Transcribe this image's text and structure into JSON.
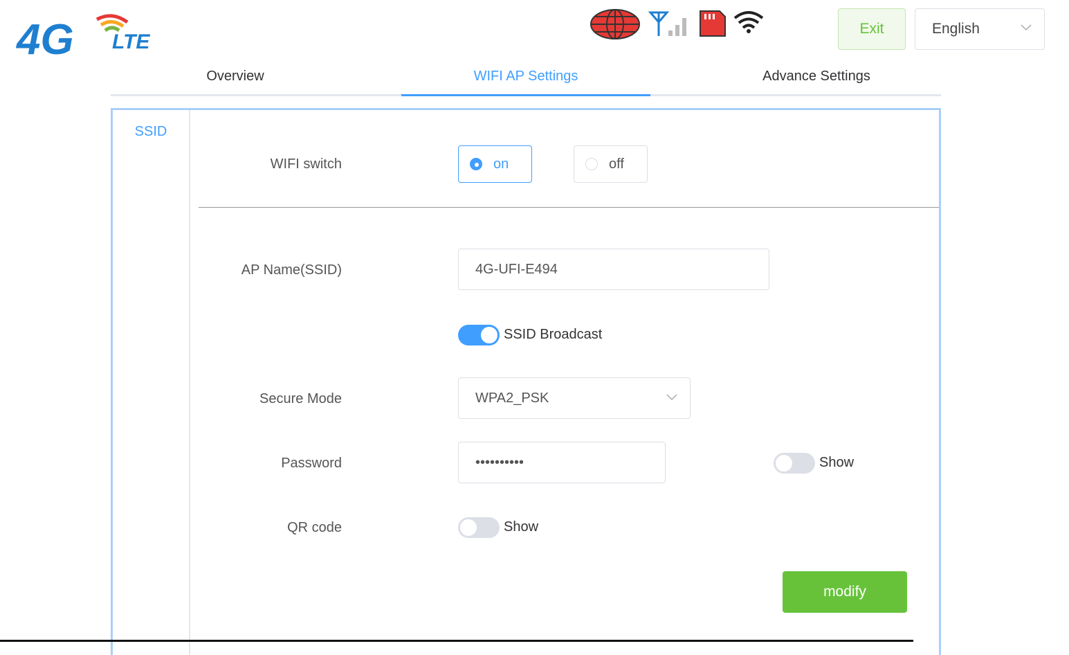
{
  "header": {
    "logo_text": "4G LTE",
    "status_icons": [
      "globe-icon",
      "signal-icon",
      "sim-card-icon",
      "wifi-icon"
    ],
    "exit_label": "Exit",
    "language": {
      "selected": "English"
    }
  },
  "tabs": [
    {
      "label": "Overview",
      "active": false
    },
    {
      "label": "WIFI AP Settings",
      "active": true
    },
    {
      "label": "Advance Settings",
      "active": false
    }
  ],
  "sidebar": {
    "items": [
      {
        "label": "SSID",
        "active": true
      }
    ]
  },
  "form": {
    "wifi_switch": {
      "label": "WIFI switch",
      "options": [
        {
          "label": "on",
          "checked": true
        },
        {
          "label": "off",
          "checked": false
        }
      ]
    },
    "ap_name": {
      "label": "AP Name(SSID)",
      "value": "4G-UFI-E494"
    },
    "ssid_broadcast": {
      "label": "SSID Broadcast",
      "enabled": true
    },
    "secure_mode": {
      "label": "Secure Mode",
      "value": "WPA2_PSK"
    },
    "password": {
      "label": "Password",
      "value": "••••••••••",
      "show_label": "Show",
      "show_enabled": false
    },
    "qr_code": {
      "label": "QR code",
      "show_label": "Show",
      "show_enabled": false
    },
    "modify_label": "modify"
  },
  "colors": {
    "accent": "#409eff",
    "success": "#67c23a",
    "panel_border": "#a9cff7"
  }
}
